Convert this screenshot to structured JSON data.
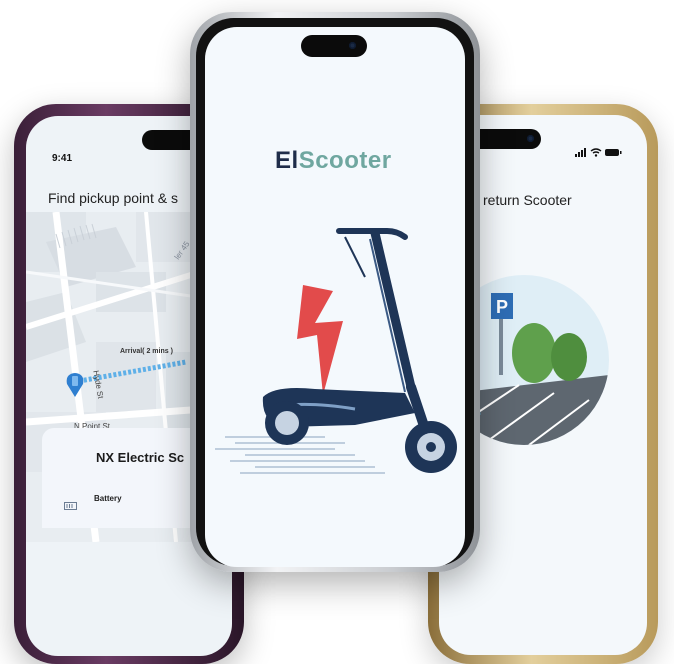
{
  "left_phone": {
    "status_time": "9:41",
    "heading": "Find pickup point & s",
    "map": {
      "street_hyde": "Hyde St",
      "street_npoint": "N Point St",
      "street_corner": "ler 45",
      "arrival_label": "Arrival( 2 mins )"
    },
    "sheet": {
      "title": "NX Electric Sc",
      "battery_label": "Battery"
    }
  },
  "center_phone": {
    "app_title_part1": "El",
    "app_title_part2": "Scooter",
    "colors": {
      "title_dark": "#1f2d4a",
      "title_accent": "#6fa7a0",
      "bolt": "#e24b4b",
      "scooter": "#1e3557"
    }
  },
  "right_phone": {
    "heading": "return Scooter",
    "parking_sign": "P"
  }
}
